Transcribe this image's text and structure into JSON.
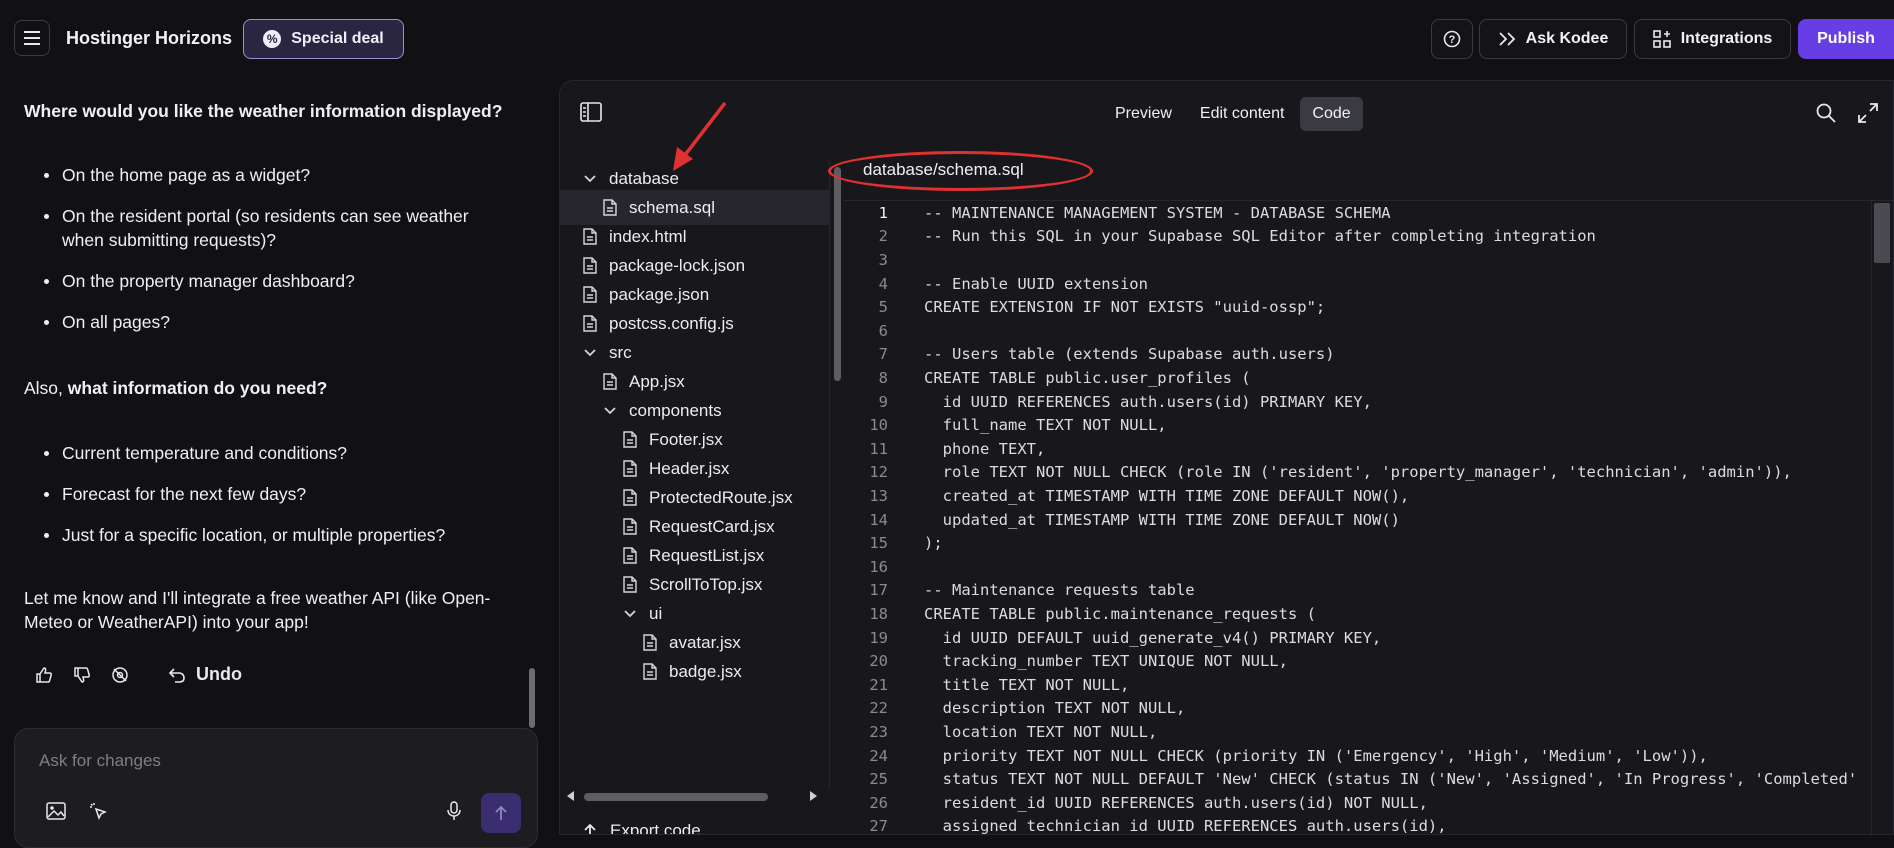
{
  "topbar": {
    "brand": "Hostinger Horizons",
    "special_deal": "Special deal",
    "ask_kodee": "Ask Kodee",
    "integrations": "Integrations",
    "publish": "Publish"
  },
  "chat": {
    "question": "Where would you like the weather information displayed?",
    "locations": [
      "On the home page as a widget?",
      "On the resident portal (so residents can see weather when submitting requests)?",
      "On the property manager dashboard?",
      "On all pages?"
    ],
    "also_prefix": "Also, ",
    "also_bold": "what information do you need?",
    "info_options": [
      "Current temperature and conditions?",
      "Forecast for the next few days?",
      "Just for a specific location, or multiple properties?"
    ],
    "final_message": "Let me know and I'll integrate a free weather API (like Open-Meteo or WeatherAPI) into your app!",
    "undo": "Undo",
    "composer_placeholder": "Ask for changes"
  },
  "editor": {
    "tabs": [
      "Preview",
      "Edit content",
      "Code"
    ],
    "active_tab": "Code",
    "file_path": "database/schema.sql",
    "export_label": "Export code",
    "tree": [
      {
        "label": "database",
        "type": "folder-open",
        "depth": 0
      },
      {
        "label": "schema.sql",
        "type": "file",
        "depth": 1,
        "selected": true
      },
      {
        "label": "index.html",
        "type": "file",
        "depth": 0
      },
      {
        "label": "package-lock.json",
        "type": "file",
        "depth": 0
      },
      {
        "label": "package.json",
        "type": "file",
        "depth": 0
      },
      {
        "label": "postcss.config.js",
        "type": "file",
        "depth": 0
      },
      {
        "label": "src",
        "type": "folder-open",
        "depth": 0
      },
      {
        "label": "App.jsx",
        "type": "file",
        "depth": 1
      },
      {
        "label": "components",
        "type": "folder-open",
        "depth": 1
      },
      {
        "label": "Footer.jsx",
        "type": "file",
        "depth": 2
      },
      {
        "label": "Header.jsx",
        "type": "file",
        "depth": 2
      },
      {
        "label": "ProtectedRoute.jsx",
        "type": "file",
        "depth": 2
      },
      {
        "label": "RequestCard.jsx",
        "type": "file",
        "depth": 2
      },
      {
        "label": "RequestList.jsx",
        "type": "file",
        "depth": 2
      },
      {
        "label": "ScrollToTop.jsx",
        "type": "file",
        "depth": 2
      },
      {
        "label": "ui",
        "type": "folder-open",
        "depth": 2
      },
      {
        "label": "avatar.jsx",
        "type": "file",
        "depth": 3
      },
      {
        "label": "badge.jsx",
        "type": "file",
        "depth": 3
      }
    ],
    "code_lines": [
      "-- MAINTENANCE MANAGEMENT SYSTEM - DATABASE SCHEMA",
      "-- Run this SQL in your Supabase SQL Editor after completing integration",
      "",
      "-- Enable UUID extension",
      "CREATE EXTENSION IF NOT EXISTS \"uuid-ossp\";",
      "",
      "-- Users table (extends Supabase auth.users)",
      "CREATE TABLE public.user_profiles (",
      "  id UUID REFERENCES auth.users(id) PRIMARY KEY,",
      "  full_name TEXT NOT NULL,",
      "  phone TEXT,",
      "  role TEXT NOT NULL CHECK (role IN ('resident', 'property_manager', 'technician', 'admin')),",
      "  created_at TIMESTAMP WITH TIME ZONE DEFAULT NOW(),",
      "  updated_at TIMESTAMP WITH TIME ZONE DEFAULT NOW()",
      ");",
      "",
      "-- Maintenance requests table",
      "CREATE TABLE public.maintenance_requests (",
      "  id UUID DEFAULT uuid_generate_v4() PRIMARY KEY,",
      "  tracking_number TEXT UNIQUE NOT NULL,",
      "  title TEXT NOT NULL,",
      "  description TEXT NOT NULL,",
      "  location TEXT NOT NULL,",
      "  priority TEXT NOT NULL CHECK (priority IN ('Emergency', 'High', 'Medium', 'Low')),",
      "  status TEXT NOT NULL DEFAULT 'New' CHECK (status IN ('New', 'Assigned', 'In Progress', 'Completed'",
      "  resident_id UUID REFERENCES auth.users(id) NOT NULL,",
      "  assigned_technician_id UUID REFERENCES auth.users(id),"
    ],
    "current_line": 1
  },
  "colors": {
    "accent": "#673de6",
    "annotation": "#e03131"
  }
}
